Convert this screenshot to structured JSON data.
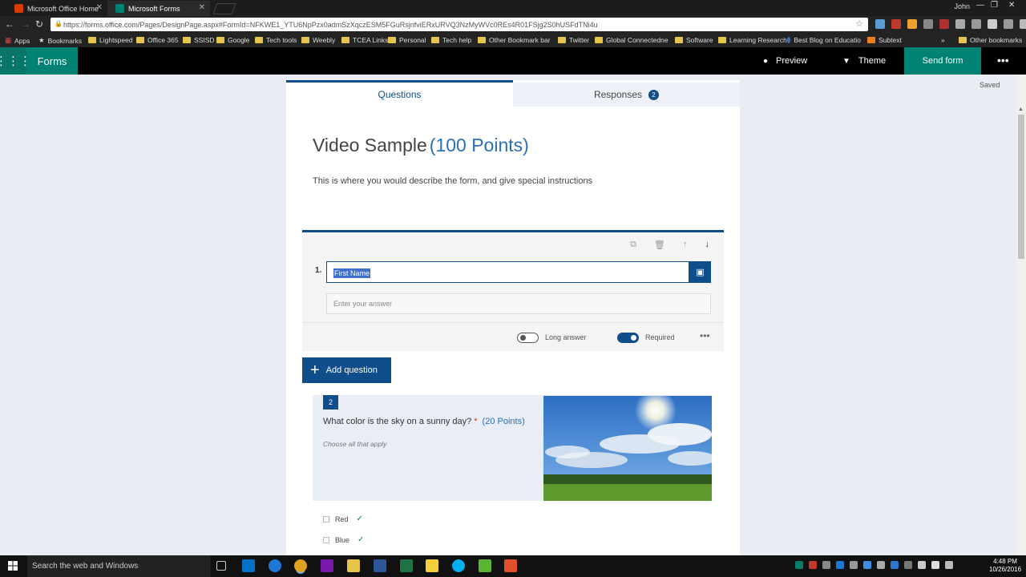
{
  "browser": {
    "tabs": [
      {
        "label": "Microsoft Office Home",
        "icon": "office-icon",
        "color": "#d83b01"
      },
      {
        "label": "Microsoft Forms",
        "icon": "forms-icon",
        "color": "#008272"
      }
    ],
    "user": "John",
    "url": "https://forms.office.com/Pages/DesignPage.aspx#FormId=NFKWE1_YTU6NpPzx0admSzXqczESM5FGuRsjnfviERxURVQ3NzMyWVc0REs4R01FSjg2S0hUSFdTNi4u",
    "bookmarks": [
      {
        "label": "Apps"
      },
      {
        "label": "Bookmarks"
      },
      {
        "label": "Lightspeed"
      },
      {
        "label": "Office 365"
      },
      {
        "label": "SSISD"
      },
      {
        "label": "Google"
      },
      {
        "label": "Tech tools"
      },
      {
        "label": "Weebly"
      },
      {
        "label": "TCEA Links"
      },
      {
        "label": "Personal"
      },
      {
        "label": "Tech help"
      },
      {
        "label": "Other Bookmark bar"
      },
      {
        "label": "Twitter"
      },
      {
        "label": "Global Connectedne"
      },
      {
        "label": "Software"
      },
      {
        "label": "Learning Research"
      },
      {
        "label": "Best Blog on Educatio"
      },
      {
        "label": "Subtext"
      },
      {
        "label": "Other bookmarks"
      }
    ]
  },
  "app": {
    "name": "Forms",
    "preview_label": "Preview",
    "theme_label": "Theme",
    "send_label": "Send form",
    "saved_label": "Saved",
    "brand_color": "#008272"
  },
  "form": {
    "tabs": {
      "questions": "Questions",
      "responses": "Responses",
      "responses_count": "2"
    },
    "title": "Video Sample",
    "points": "(100 Points)",
    "description": "This is where you would describe the form, and give special instructions",
    "q1": {
      "number": "1.",
      "title": "First Name",
      "answer_placeholder": "Enter your answer",
      "long_answer_label": "Long answer",
      "required_label": "Required",
      "long_answer": false,
      "required": true
    },
    "add_question_label": "Add question",
    "q2": {
      "number": "2",
      "text": "What color is the sky on a sunny day?",
      "required_mark": "*",
      "points": "(20 Points)",
      "hint": "Choose all that apply",
      "options": [
        {
          "label": "Red",
          "correct": true
        },
        {
          "label": "Blue",
          "correct": true
        }
      ]
    }
  },
  "taskbar": {
    "search_placeholder": "Search the web and Windows",
    "time": "4:48 PM",
    "date": "10/26/2016"
  }
}
